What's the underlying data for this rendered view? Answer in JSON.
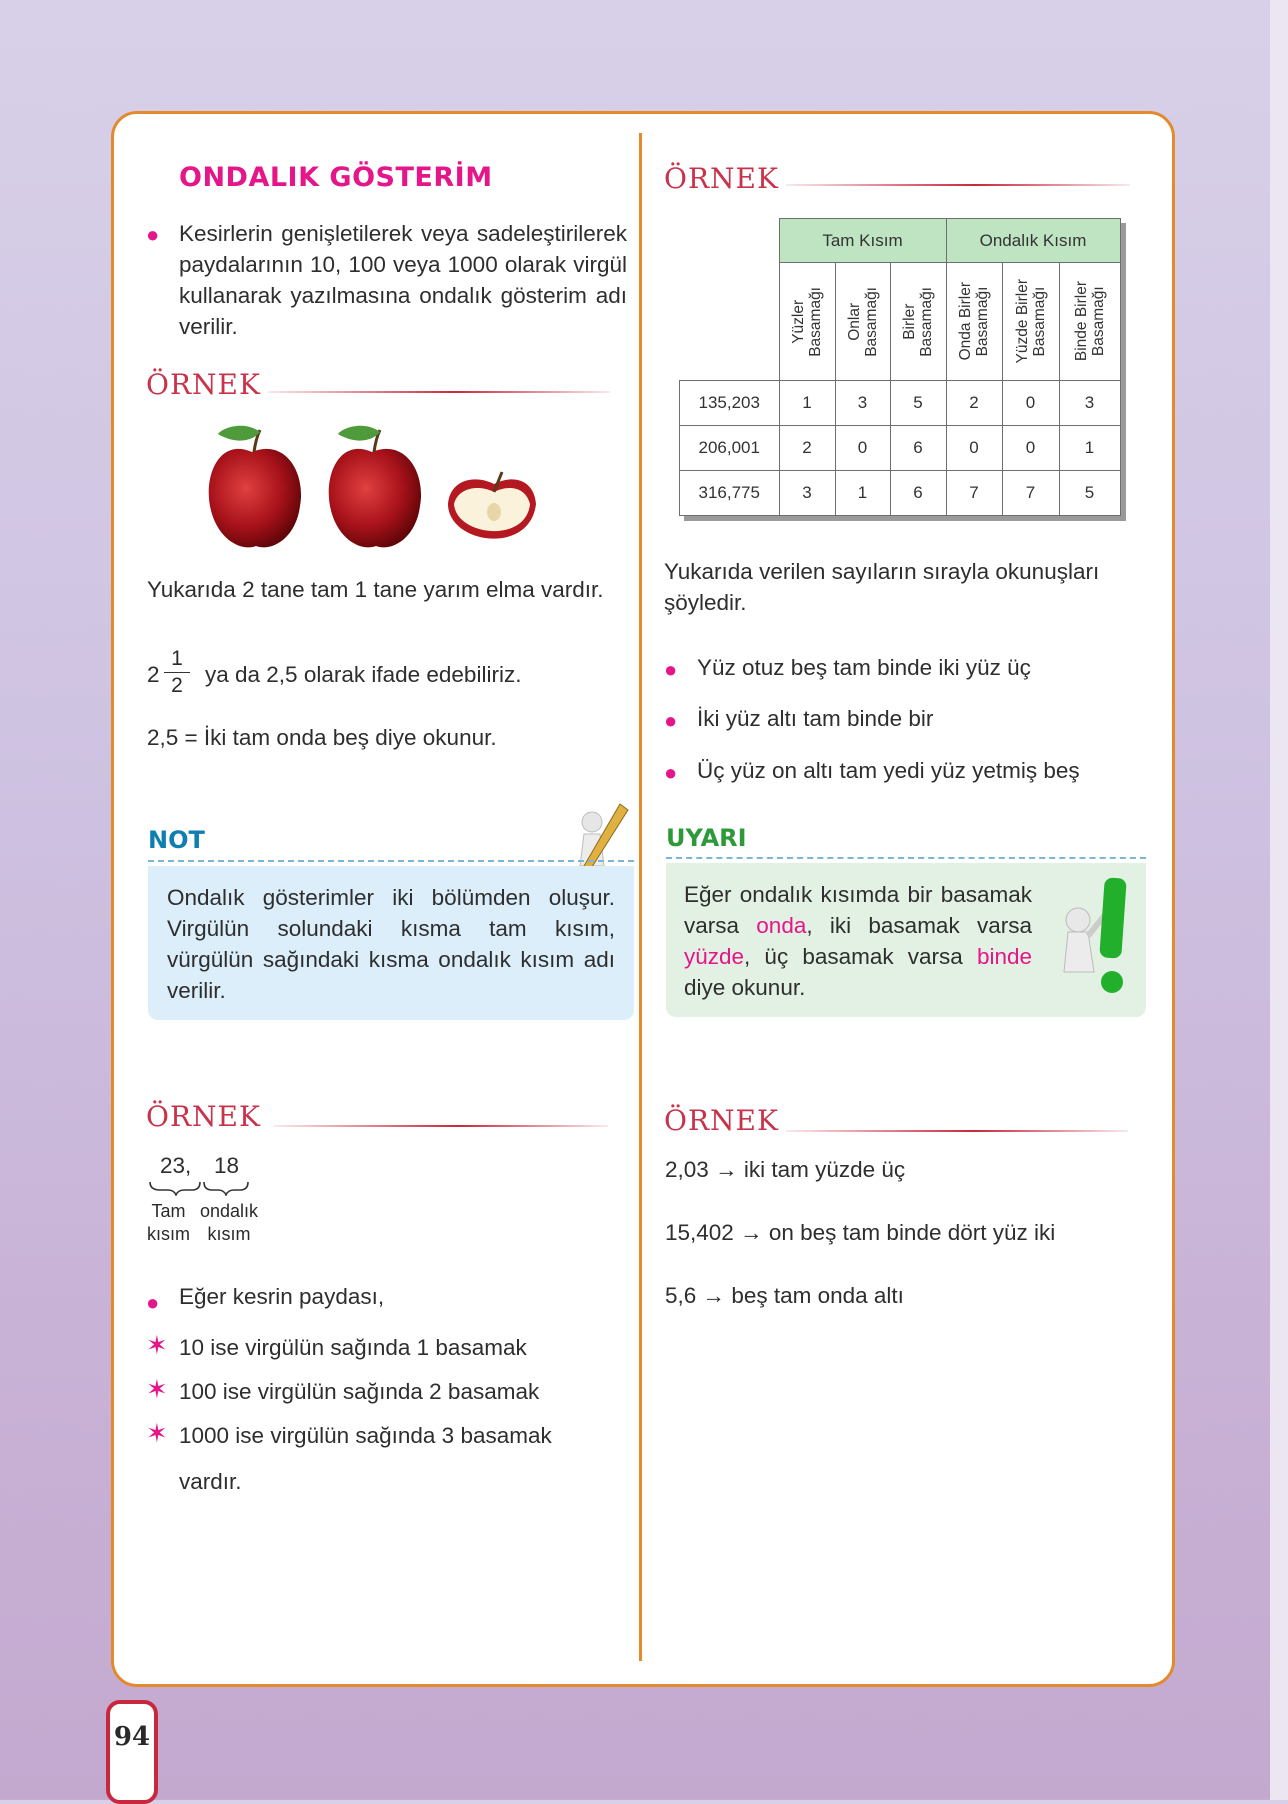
{
  "page_number": "94",
  "left": {
    "title": "ONDALIK GÖSTERİM",
    "intro": "Kesirlerin genişletilerek veya sadeleştirilerek paydalarının 10, 100 veya 1000 olarak virgül kullanarak yazılmasına ondalık gösterim adı verilir.",
    "ornek_label": "ÖRNEK",
    "apples_text": "Yukarıda 2 tane tam 1 tane yarım elma vardır.",
    "mixed_whole": "2",
    "mixed_num": "1",
    "mixed_den": "2",
    "mixed_rest": "ya da 2,5 olarak ifade edebiliriz.",
    "reading": "2,5 = İki tam onda beş diye okunur.",
    "note_heading": "NOT",
    "note_text": "Ondalık gösterimler iki bölümden oluşur. Virgülün solundaki kısma tam kısım, vürgülün sağındaki kısma ondalık kısım adı verilir.",
    "ornek2_label": "ÖRNEK",
    "example_whole": "23,",
    "example_dec": "18",
    "label_tam_1": "Tam",
    "label_tam_2": "kısım",
    "label_ond_1": "ondalık",
    "label_ond_2": "kısım",
    "payda_intro": "Eğer kesrin paydası,",
    "rules": [
      "10 ise virgülün sağında 1 basamak",
      "100 ise virgülün sağında 2 basamak",
      "1000 ise virgülün sağında 3 basamak"
    ],
    "vardir": "vardır."
  },
  "right": {
    "ornek_label": "ÖRNEK",
    "table": {
      "group_tam": "Tam Kısım",
      "group_ondalik": "Ondalık Kısım",
      "columns": [
        [
          "Yüzler",
          "Basamağı"
        ],
        [
          "Onlar",
          "Basamağı"
        ],
        [
          "Birler",
          "Basamağı"
        ],
        [
          "Onda Birler",
          "Basamağı"
        ],
        [
          "Yüzde Birler",
          "Basamağı"
        ],
        [
          "Binde Birler",
          "Basamağı"
        ]
      ],
      "rows": [
        {
          "number": "135,203",
          "digits": [
            "1",
            "3",
            "5",
            "2",
            "0",
            "3"
          ]
        },
        {
          "number": "206,001",
          "digits": [
            "2",
            "0",
            "6",
            "0",
            "0",
            "1"
          ]
        },
        {
          "number": "316,775",
          "digits": [
            "3",
            "1",
            "6",
            "7",
            "7",
            "5"
          ]
        }
      ]
    },
    "readings_intro": "Yukarıda verilen sayıların sırayla okunuşları şöyledir.",
    "readings": [
      "Yüz otuz beş tam binde iki yüz üç",
      "İki yüz altı tam binde bir",
      "Üç yüz on altı tam yedi yüz yetmiş beş"
    ],
    "warn_heading": "UYARI",
    "warn": {
      "p1": "Eğer ondalık kısımda bir basamak varsa ",
      "k1": "onda",
      "p2": ", iki basamak varsa ",
      "k2": "yüzde",
      "p3": ", üç basamak varsa ",
      "k3": "binde",
      "p4": " diye okunur."
    },
    "ornek2_label": "ÖRNEK",
    "examples": [
      {
        "num": "2,03",
        "arrow": "→",
        "text": "iki tam yüzde üç"
      },
      {
        "num": "15,402",
        "arrow": "→",
        "text": "on beş tam binde dört yüz iki"
      },
      {
        "num": "5,6",
        "arrow": "→",
        "text": "beş tam onda altı"
      }
    ]
  },
  "colors": {
    "accent_pink": "#e5168a",
    "orange_frame": "#e38a2d",
    "note_blue": "#0e7fb0",
    "warn_green": "#2d9a3a",
    "table_header": "#bfe4c2"
  }
}
